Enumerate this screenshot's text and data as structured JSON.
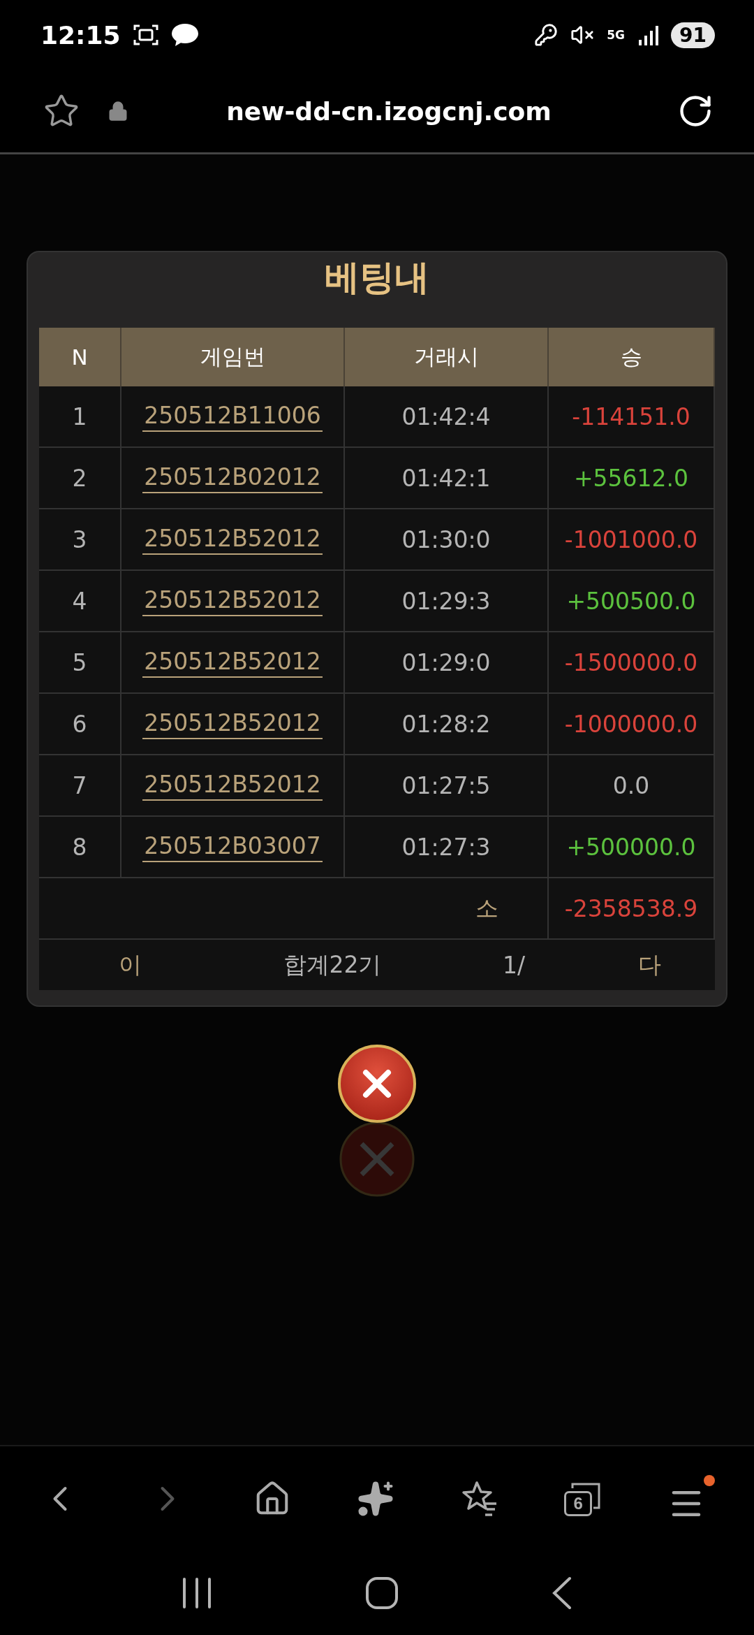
{
  "status_bar": {
    "time": "12:15",
    "network": "5G",
    "battery": "91"
  },
  "browser": {
    "url": "new-dd-cn.izogcnj.com"
  },
  "modal": {
    "title": "베팅내",
    "columns": [
      "N",
      "게임번",
      "거래시",
      "승"
    ],
    "rows": [
      {
        "no": "1",
        "game": "250512B11006",
        "time": "01:42:4",
        "amount": "-114151.0",
        "color": "#d9433b"
      },
      {
        "no": "2",
        "game": "250512B02012",
        "time": "01:42:1",
        "amount": "+55612.0",
        "color": "#5cc23e"
      },
      {
        "no": "3",
        "game": "250512B52012",
        "time": "01:30:0",
        "amount": "-1001000.0",
        "color": "#d9433b"
      },
      {
        "no": "4",
        "game": "250512B52012",
        "time": "01:29:3",
        "amount": "+500500.0",
        "color": "#5cc23e"
      },
      {
        "no": "5",
        "game": "250512B52012",
        "time": "01:29:0",
        "amount": "-1500000.0",
        "color": "#d9433b"
      },
      {
        "no": "6",
        "game": "250512B52012",
        "time": "01:28:2",
        "amount": "-1000000.0",
        "color": "#d9433b"
      },
      {
        "no": "7",
        "game": "250512B52012",
        "time": "01:27:5",
        "amount": "0.0",
        "color": "#b4b4b4"
      },
      {
        "no": "8",
        "game": "250512B03007",
        "time": "01:27:3",
        "amount": "+500000.0",
        "color": "#5cc23e"
      }
    ],
    "subtotal": {
      "label": "소",
      "amount": "-2358538.9"
    },
    "pager": {
      "prev": "이",
      "total": "합계22기",
      "page": "1/",
      "next": "다"
    }
  },
  "toolbar": {
    "back_disabled": false,
    "forward_disabled": true,
    "tab_count": "6",
    "menu_badge": true
  }
}
